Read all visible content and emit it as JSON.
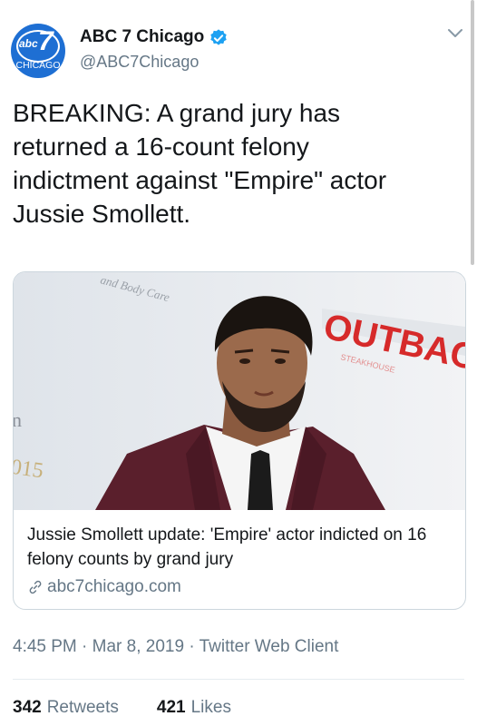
{
  "author": {
    "name": "ABC 7 Chicago",
    "handle": "@ABC7Chicago",
    "avatar_word": "abc",
    "avatar_number": "7",
    "avatar_city": "CHICAGO",
    "avatar_color": "#1e6fd3",
    "verified_icon": "verified-badge-icon"
  },
  "tweet": {
    "text": "BREAKING: A grand jury has\nreturned a 16-count felony\nindictment against \"Empire\" actor\nJussie Smollett."
  },
  "card": {
    "image_sign_text": "OUTBAC",
    "image_sign_sub": "STEAKHOUSE",
    "image_backdrop_text": "and Body Care",
    "image_backdrop_left": "n",
    "image_backdrop_year": "015",
    "title": "Jussie Smollett update: 'Empire' actor indicted on 16 felony counts by grand jury",
    "domain": "abc7chicago.com",
    "link_icon": "link-icon"
  },
  "meta": {
    "time": "4:45 PM · Mar 8, 2019 · Twitter Web Client"
  },
  "stats": {
    "retweets_count": "342",
    "retweets_label": "Retweets",
    "likes_count": "421",
    "likes_label": "Likes"
  },
  "colors": {
    "text": "#14171a",
    "secondary": "#657786",
    "verified": "#1da1f2",
    "border": "#ccd6dd"
  }
}
